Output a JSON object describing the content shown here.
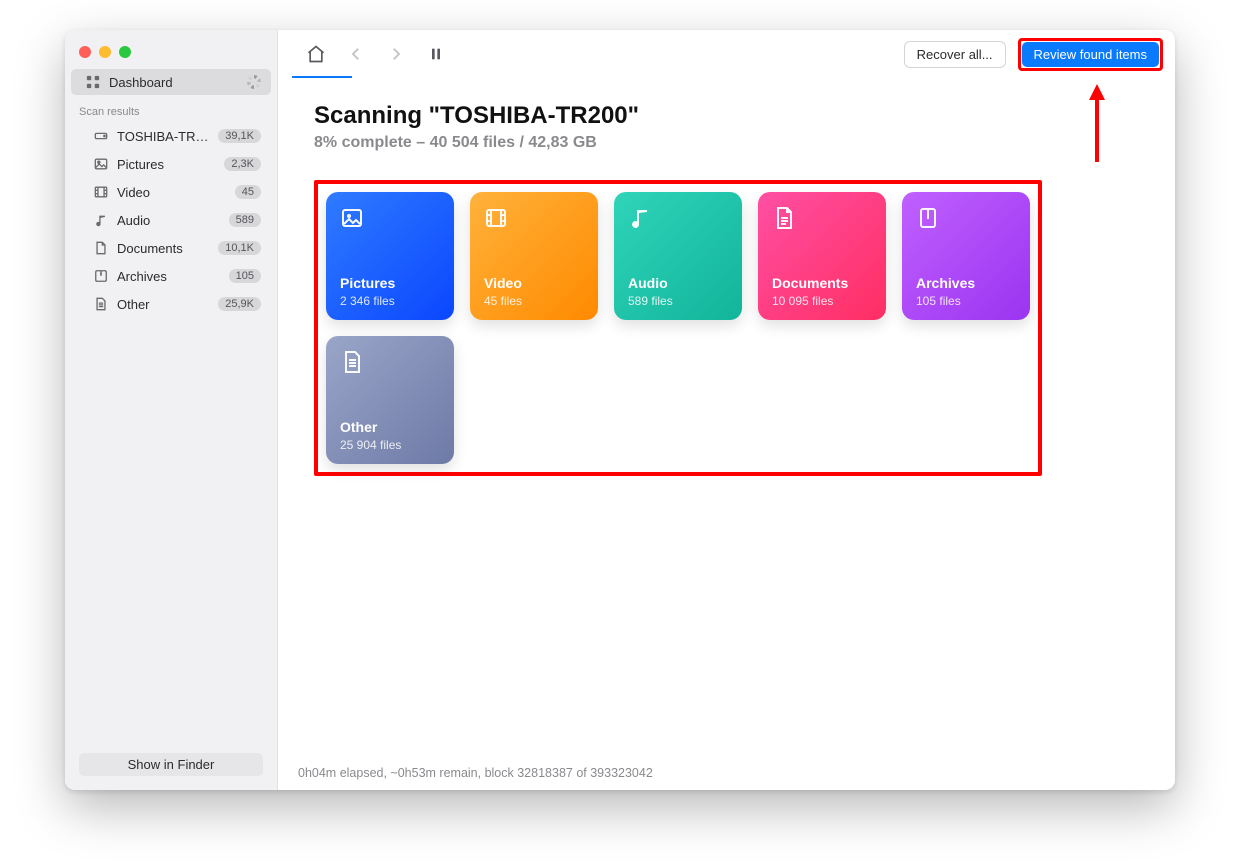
{
  "sidebar": {
    "dashboard_label": "Dashboard",
    "section_label": "Scan results",
    "items": [
      {
        "label": "TOSHIBA-TR200",
        "count": "39,1K"
      },
      {
        "label": "Pictures",
        "count": "2,3K"
      },
      {
        "label": "Video",
        "count": "45"
      },
      {
        "label": "Audio",
        "count": "589"
      },
      {
        "label": "Documents",
        "count": "10,1K"
      },
      {
        "label": "Archives",
        "count": "105"
      },
      {
        "label": "Other",
        "count": "25,9K"
      }
    ],
    "finder_button": "Show in Finder"
  },
  "toolbar": {
    "recover_label": "Recover all...",
    "review_label": "Review found items"
  },
  "scan": {
    "title": "Scanning \"TOSHIBA-TR200\"",
    "subtitle": "8% complete – 40 504 files / 42,83 GB"
  },
  "cards": [
    {
      "key": "pictures",
      "title": "Pictures",
      "sub": "2 346 files"
    },
    {
      "key": "video",
      "title": "Video",
      "sub": "45 files"
    },
    {
      "key": "audio",
      "title": "Audio",
      "sub": "589 files"
    },
    {
      "key": "documents",
      "title": "Documents",
      "sub": "10 095 files"
    },
    {
      "key": "archives",
      "title": "Archives",
      "sub": "105 files"
    },
    {
      "key": "other",
      "title": "Other",
      "sub": "25 904 files"
    }
  ],
  "status": "0h04m elapsed, ~0h53m remain, block 32818387 of 393323042"
}
